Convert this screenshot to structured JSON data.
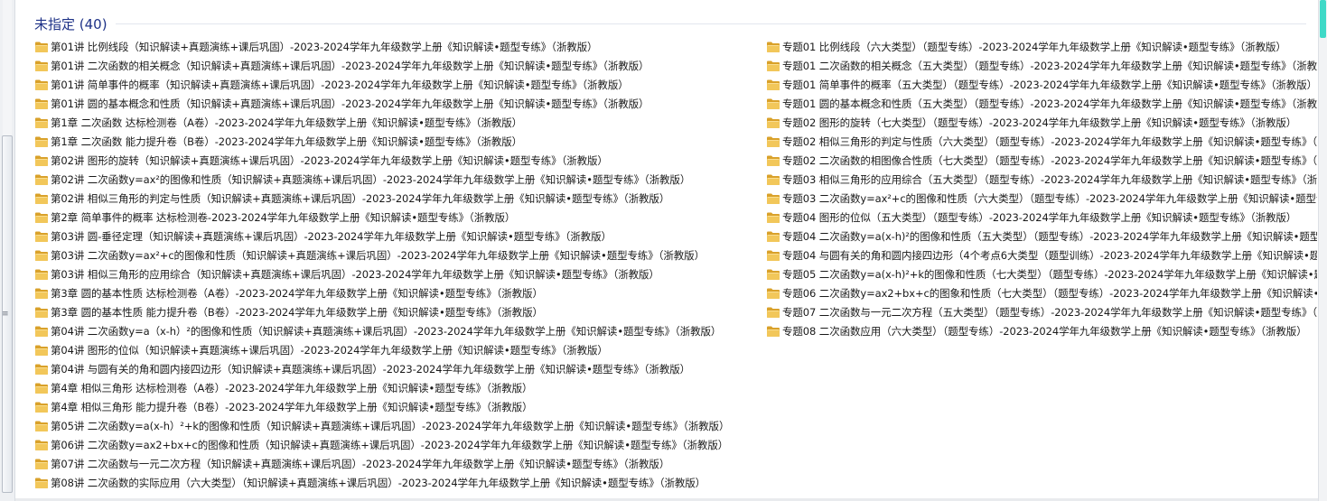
{
  "group": {
    "title": "未指定 (40)"
  },
  "icons": {
    "folder": "folder-icon",
    "folder_color": "#e8b53a"
  },
  "left_items": [
    "第01讲 比例线段（知识解读+真题演练+课后巩固）-2023-2024学年九年级数学上册《知识解读•题型专练》（浙教版）",
    "第01讲 二次函数的相关概念（知识解读+真题演练+课后巩固）-2023-2024学年九年级数学上册《知识解读•题型专练》（浙教版）",
    "第01讲 简单事件的概率（知识解读+真题演练+课后巩固）-2023-2024学年九年级数学上册《知识解读•题型专练》（浙教版）",
    "第01讲 圆的基本概念和性质（知识解读+真题演练+课后巩固）-2023-2024学年九年级数学上册《知识解读•题型专练》（浙教版）",
    "第1章 二次函数 达标检测卷（A卷）-2023-2024学年九年级数学上册《知识解读•题型专练》（浙教版）",
    "第1章 二次函数 能力提升卷（B卷）-2023-2024学年九年级数学上册《知识解读•题型专练》（浙教版）",
    "第02讲 图形的旋转（知识解读+真题演练+课后巩固）-2023-2024学年九年级数学上册《知识解读•题型专练》（浙教版）",
    "第02讲 二次函数y=ax²的图像和性质（知识解读+真题演练+课后巩固）-2023-2024学年九年级数学上册《知识解读•题型专练》（浙教版）",
    "第02讲 相似三角形的判定与性质（知识解读+真题演练+课后巩固）-2023-2024学年九年级数学上册《知识解读•题型专练》（浙教版）",
    "第2章 简单事件的概率 达标检测卷-2023-2024学年九年级数学上册《知识解读•题型专练》（浙教版）",
    "第03讲 圆-垂径定理（知识解读+真题演练+课后巩固）-2023-2024学年九年级数学上册《知识解读•题型专练》（浙教版）",
    "第03讲 二次函数y=ax²+c的图像和性质（知识解读+真题演练+课后巩固）-2023-2024学年九年级数学上册《知识解读•题型专练》（浙教版）",
    "第03讲 相似三角形的应用综合（知识解读+真题演练+课后巩固）-2023-2024学年九年级数学上册《知识解读•题型专练》（浙教版）",
    "第3章 圆的基本性质 达标检测卷（A卷）-2023-2024学年九年级数学上册《知识解读•题型专练》（浙教版）",
    "第3章 圆的基本性质 能力提升卷（B卷）-2023-2024学年九年级数学上册《知识解读•题型专练》（浙教版）",
    "第04讲 二次函数y=a（x-h）²的图像和性质（知识解读+真题演练+课后巩固）-2023-2024学年九年级数学上册《知识解读•题型专练》（浙教版）",
    "第04讲 图形的位似（知识解读+真题演练+课后巩固）-2023-2024学年九年级数学上册《知识解读•题型专练》（浙教版）",
    "第04讲 与圆有关的角和圆内接四边形（知识解读+真题演练+课后巩固）-2023-2024学年九年级数学上册《知识解读•题型专练》（浙教版）",
    "第4章 相似三角形 达标检测卷（A卷）-2023-2024学年九年级数学上册《知识解读•题型专练》（浙教版）",
    "第4章 相似三角形 能力提升卷（B卷）-2023-2024学年九年级数学上册《知识解读•题型专练》（浙教版）",
    "第05讲 二次函数y=a(x-h）²+k的图像和性质（知识解读+真题演练+课后巩固）-2023-2024学年九年级数学上册《知识解读•题型专练》（浙教版）",
    "第06讲 二次函数y=ax2+bx+c的图像和性质（知识解读+真题演练+课后巩固）-2023-2024学年九年级数学上册《知识解读•题型专练》（浙教版）",
    "第07讲 二次函数与一元二次方程（知识解读+真题演练+课后巩固）-2023-2024学年九年级数学上册《知识解读•题型专练》（浙教版）",
    "第08讲 二次函数的实际应用（六大类型）（知识解读+真题演练+课后巩固）-2023-2024学年九年级数学上册《知识解读•题型专练》（浙教版）"
  ],
  "right_items": [
    "专题01 比例线段（六大类型）（题型专练）-2023-2024学年九年级数学上册《知识解读•题型专练》（浙教版）",
    "专题01 二次函数的相关概念（五大类型）（题型专练）-2023-2024学年九年级数学上册《知识解读•题型专练》（浙教版）",
    "专题01 简单事件的概率（五大类型）（题型专练）-2023-2024学年九年级数学上册《知识解读•题型专练》（浙教版）",
    "专题01 圆的基本概念和性质（五大类型）（题型专练）-2023-2024学年九年级数学上册《知识解读•题型专练》（浙教版）",
    "专题02 图形的旋转（七大类型）（题型专练）-2023-2024学年九年级数学上册《知识解读•题型专练》（浙教版）",
    "专题02 相似三角形的判定与性质（六大类型）（题型专练）-2023-2024学年九年级数学上册《知识解读•题型专练》（浙教版）",
    "专题02 二次函数的相图像合性质（七大类型）（题型专练）-2023-2024学年九年级数学上册《知识解读•题型专练》（浙教版）",
    "专题03 相似三角形的应用综合（五大类型）（题型专练）-2023-2024学年九年级数学上册《知识解读•题型专练》（浙教版）",
    "专题03 二次函数y=ax²+c的图像和性质（六大类型）（题型专练）-2023-2024学年九年级数学上册《知识解读•题型专练》（浙教版）",
    "专题04 图形的位似（五大类型）（题型专练）-2023-2024学年九年级数学上册《知识解读•题型专练》（浙教版）",
    "专题04 二次函数y=a(x-h)²的图像和性质（五大类型）（题型专练）-2023-2024学年九年级数学上册《知识解读•题型专练》（浙教版）",
    "专题04 与圆有关的角和圆内接四边形（4个考点6大类型（题型训练）-2023-2024学年九年级数学上册《知识解读•题型专练》（浙教版）",
    "专题05 二次函数y=a(x-h)²+k的图像和性质（七大类型）（题型专练）-2023-2024学年九年级数学上册《知识解读•题型专练》（浙教版）",
    "专题06 二次函数y=ax2+bx+c的图象和性质（七大类型）（题型专练）-2023-2024学年九年级数学上册《知识解读•题型专练》（浙教版）",
    "专题07 二次函数与一元二次方程（五大类型）（题型专练）-2023-2024学年九年级数学上册《知识解读•题型专练》（浙教版）",
    "专题08 二次函数应用（六大类型）（题型专练）-2023-2024学年九年级数学上册《知识解读•题型专练》（浙教版）"
  ]
}
